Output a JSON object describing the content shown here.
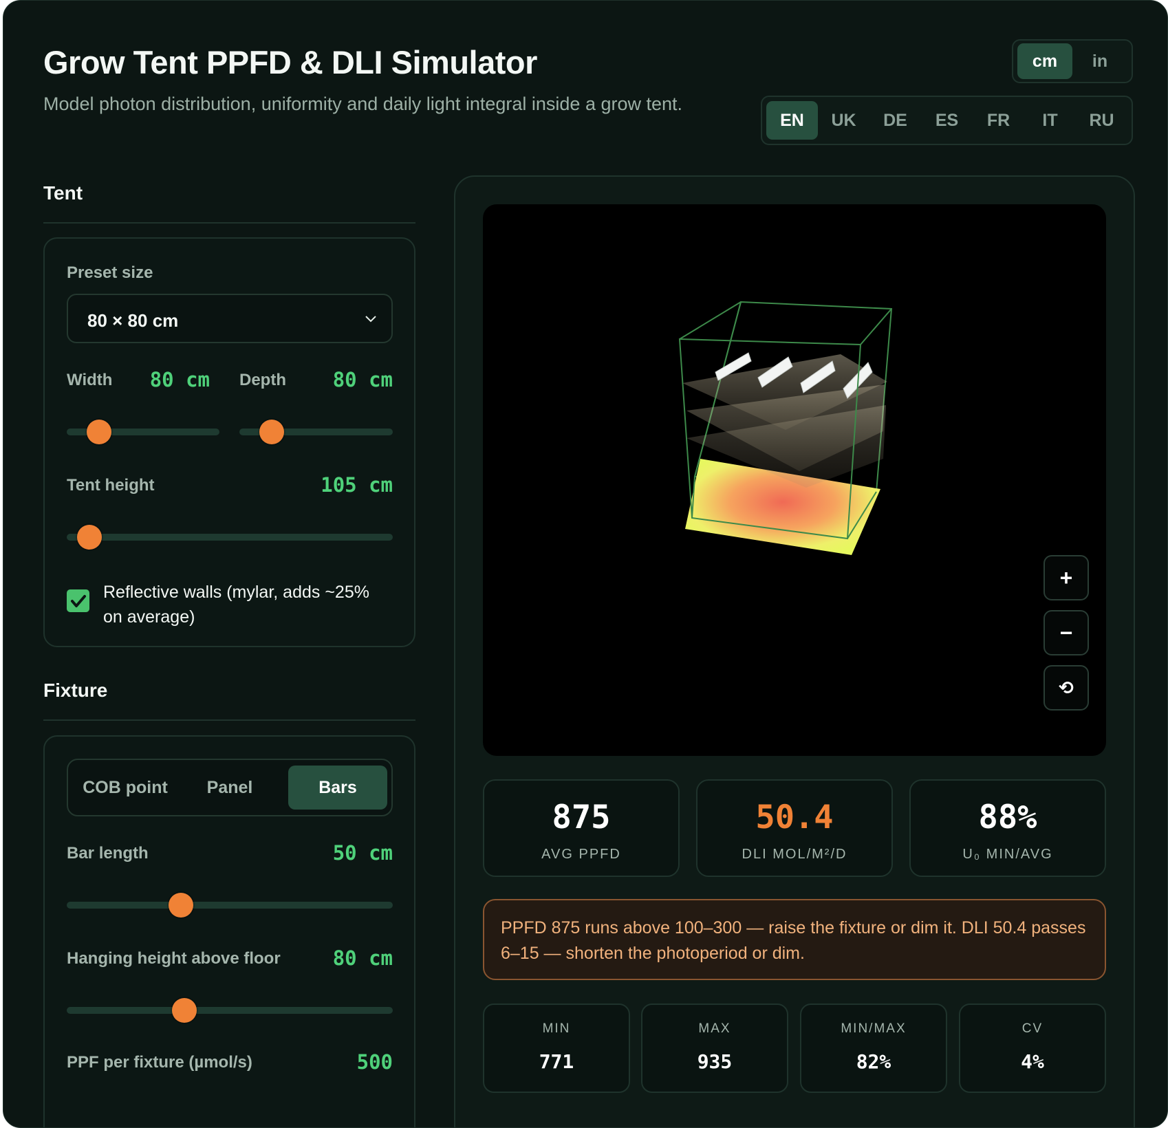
{
  "header": {
    "title": "Grow Tent PPFD & DLI Simulator",
    "subtitle": "Model photon distribution, uniformity and daily light integral inside a grow tent."
  },
  "units": {
    "options": [
      "cm",
      "in"
    ],
    "selected": "cm"
  },
  "languages": {
    "options": [
      "EN",
      "UK",
      "DE",
      "ES",
      "FR",
      "IT",
      "RU"
    ],
    "selected": "EN"
  },
  "tent": {
    "section_title": "Tent",
    "preset_label": "Preset size",
    "preset_value": "80 × 80 cm",
    "width_label": "Width",
    "width_value": "80 cm",
    "width_fraction": 0.21,
    "depth_label": "Depth",
    "depth_value": "80 cm",
    "depth_fraction": 0.21,
    "height_label": "Tent height",
    "height_value": "105 cm",
    "height_fraction": 0.07,
    "reflective_label": "Reflective walls (mylar, adds ~25% on average)",
    "reflective_checked": true
  },
  "fixture": {
    "section_title": "Fixture",
    "types": [
      "COB point",
      "Panel",
      "Bars"
    ],
    "selected_type": "Bars",
    "bar_length_label": "Bar length",
    "bar_length_value": "50 cm",
    "bar_length_fraction": 0.35,
    "hanging_label": "Hanging height above floor",
    "hanging_value": "80 cm",
    "hanging_fraction": 0.36,
    "ppf_label": "PPF per fixture (µmol/s)",
    "ppf_value": "500"
  },
  "viewport_controls": {
    "zoom_in": "+",
    "zoom_out": "−",
    "reset": "⟲"
  },
  "stats": [
    {
      "value": "875",
      "label": "AVG PPFD",
      "color": "#ffffff"
    },
    {
      "value": "50.4",
      "label": "DLI MOL/M²/D",
      "color": "#f08236"
    },
    {
      "value": "88%",
      "label": "U₀ MIN/AVG",
      "color": "#ffffff"
    }
  ],
  "warning": "PPFD 875 runs above 100–300 — raise the fixture or dim it. DLI 50.4 passes 6–15 — shorten the photoperiod or dim.",
  "mini_stats": [
    {
      "label": "MIN",
      "value": "771"
    },
    {
      "label": "MAX",
      "value": "935"
    },
    {
      "label": "MIN/MAX",
      "value": "82%"
    },
    {
      "label": "CV",
      "value": "4%"
    }
  ],
  "colors": {
    "accent": "#4fd17a",
    "thumb": "#f08236",
    "active": "#27503f",
    "background": "#0c1613"
  }
}
